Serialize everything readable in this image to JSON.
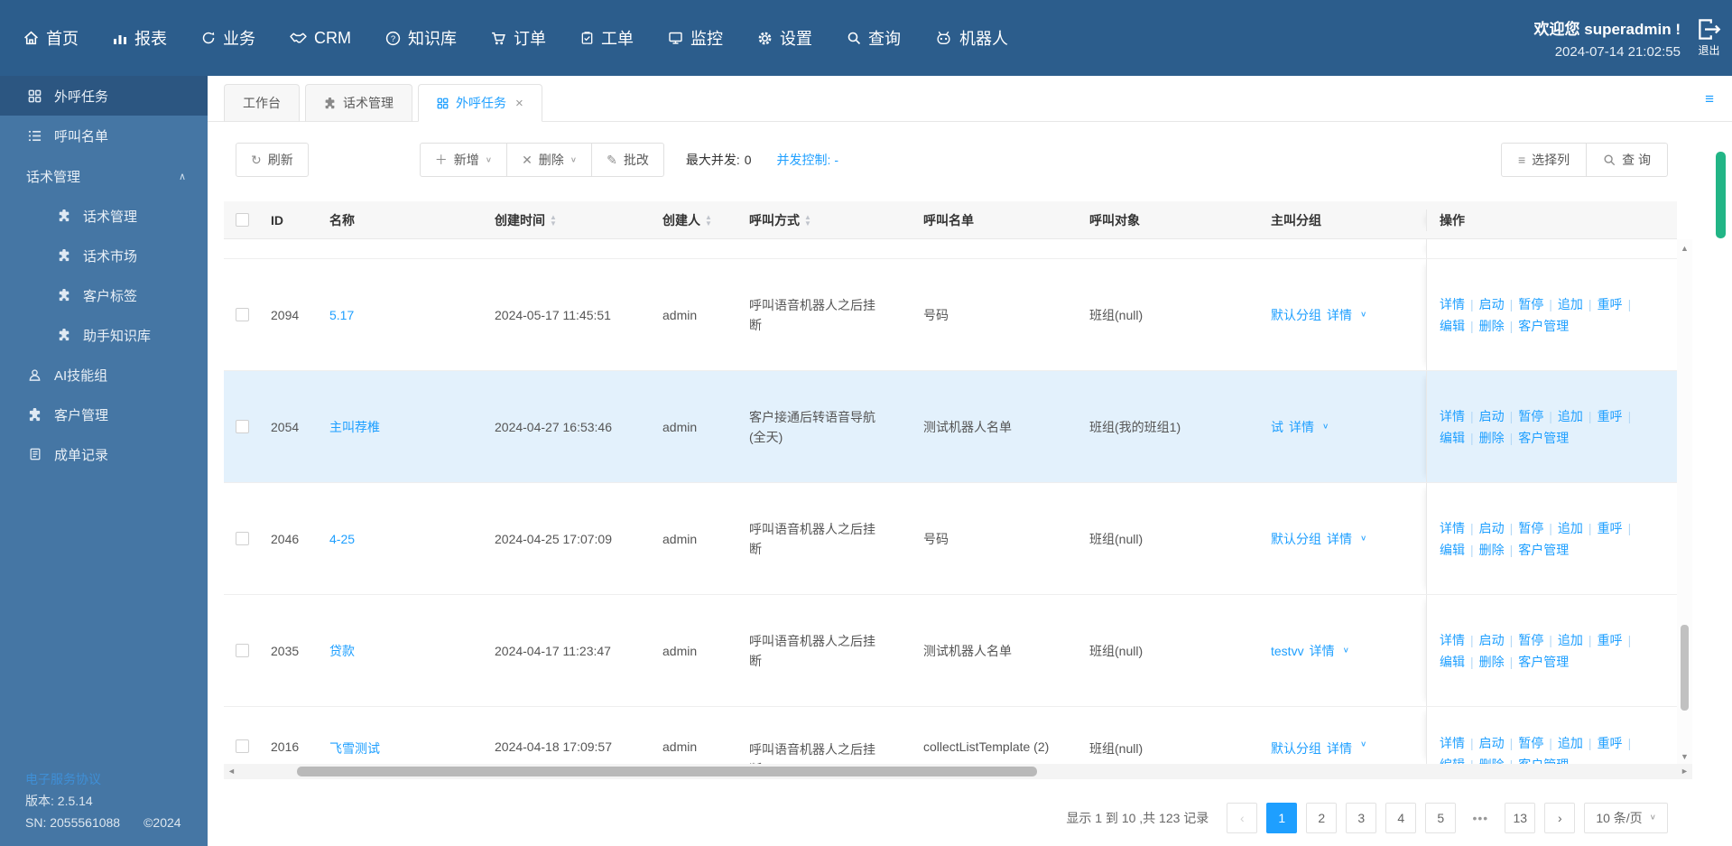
{
  "colors": {
    "navbar_bg": "#2c5d8c",
    "sidebar_bg": "#4576a4",
    "accent_blue": "#1e9fff",
    "row_highlight": "#e3f1fc",
    "page_scroll_green": "#22b586"
  },
  "navbar": {
    "items": [
      {
        "label": "首页",
        "icon": "home-icon"
      },
      {
        "label": "报表",
        "icon": "chart-icon"
      },
      {
        "label": "业务",
        "icon": "sync-icon"
      },
      {
        "label": "CRM",
        "icon": "handshake-icon"
      },
      {
        "label": "知识库",
        "icon": "question-circle-icon"
      },
      {
        "label": "订单",
        "icon": "cart-icon"
      },
      {
        "label": "工单",
        "icon": "clipboard-icon"
      },
      {
        "label": "监控",
        "icon": "monitor-icon"
      },
      {
        "label": "设置",
        "icon": "gear-icon"
      },
      {
        "label": "查询",
        "icon": "search-icon"
      },
      {
        "label": "机器人",
        "icon": "robot-icon"
      }
    ],
    "welcome": "欢迎您 superadmin !",
    "datetime": "2024-07-14 21:02:55",
    "logout_label": "退出"
  },
  "sidebar": {
    "items": [
      {
        "label": "外呼任务",
        "icon": "grid-icon"
      },
      {
        "label": "呼叫名单",
        "icon": "list-icon"
      },
      {
        "label": "话术管理"
      },
      {
        "label": "话术管理",
        "icon": "puzzle-icon"
      },
      {
        "label": "话术市场",
        "icon": "puzzle-icon"
      },
      {
        "label": "客户标签",
        "icon": "puzzle-icon"
      },
      {
        "label": "助手知识库",
        "icon": "puzzle-icon"
      },
      {
        "label": "AI技能组",
        "icon": "person-icon"
      },
      {
        "label": "客户管理",
        "icon": "puzzle-icon"
      },
      {
        "label": "成单记录",
        "icon": "document-icon"
      }
    ],
    "footer": {
      "agreement": "电子服务协议",
      "version": "版本: 2.5.14",
      "sn": "SN: 2055561088",
      "copyright": "©2024"
    }
  },
  "tabs": [
    {
      "label": "工作台"
    },
    {
      "label": "话术管理",
      "icon": "puzzle-icon"
    },
    {
      "label": "外呼任务",
      "icon": "grid-icon",
      "closable": true
    }
  ],
  "toolbar": {
    "refresh": "刷新",
    "add": "新增",
    "delete": "删除",
    "batch": "批改",
    "max_concurrency_label": "最大并发:",
    "max_concurrency_value": "0",
    "concurrency_control": "并发控制: -",
    "select_columns": "选择列",
    "search": "查 询"
  },
  "table": {
    "columns": [
      {
        "label": "ID"
      },
      {
        "label": "名称"
      },
      {
        "label": "创建时间",
        "sortable": true
      },
      {
        "label": "创建人",
        "sortable": true
      },
      {
        "label": "呼叫方式",
        "sortable": true
      },
      {
        "label": "呼叫名单"
      },
      {
        "label": "呼叫对象"
      },
      {
        "label": "主叫分组"
      },
      {
        "label": "操作"
      }
    ],
    "detail_label": "详情",
    "ops": [
      "详情",
      "启动",
      "暂停",
      "追加",
      "重呼",
      "编辑",
      "删除",
      "客户管理"
    ],
    "rows": [
      {
        "id": "2094",
        "name": "5.17",
        "created": "2024-05-17 11:45:51",
        "creator": "admin",
        "method": "呼叫语音机器人之后挂断",
        "list": "号码",
        "target": "班组(null)",
        "group_name": "默认分组"
      },
      {
        "id": "2054",
        "name": "主叫荐椎",
        "created": "2024-04-27 16:53:46",
        "creator": "admin",
        "method": "客户接通后转语音导航(全天)",
        "list": "测试机器人名单",
        "target": "班组(我的班组1)",
        "group_name": "试"
      },
      {
        "id": "2046",
        "name": "4-25",
        "created": "2024-04-25 17:07:09",
        "creator": "admin",
        "method": "呼叫语音机器人之后挂断",
        "list": "号码",
        "target": "班组(null)",
        "group_name": "默认分组"
      },
      {
        "id": "2035",
        "name": "贷款",
        "created": "2024-04-17 11:23:47",
        "creator": "admin",
        "method": "呼叫语音机器人之后挂断",
        "list": "测试机器人名单",
        "target": "班组(null)",
        "group_name": "testvv"
      },
      {
        "id": "2016",
        "name": "飞雪测试",
        "created": "2024-04-18 17:09:57",
        "creator": "admin",
        "method": "呼叫语音机器人之后挂断",
        "list": "collectListTemplate (2)",
        "target": "班组(null)",
        "group_name": "默认分组"
      }
    ]
  },
  "pagination": {
    "summary": "显示 1 到 10 ,共 123 记录",
    "prev": "‹",
    "pages": [
      "1",
      "2",
      "3",
      "4",
      "5"
    ],
    "dots": "•••",
    "last": "13",
    "next": "›",
    "page_size": "10 条/页"
  }
}
